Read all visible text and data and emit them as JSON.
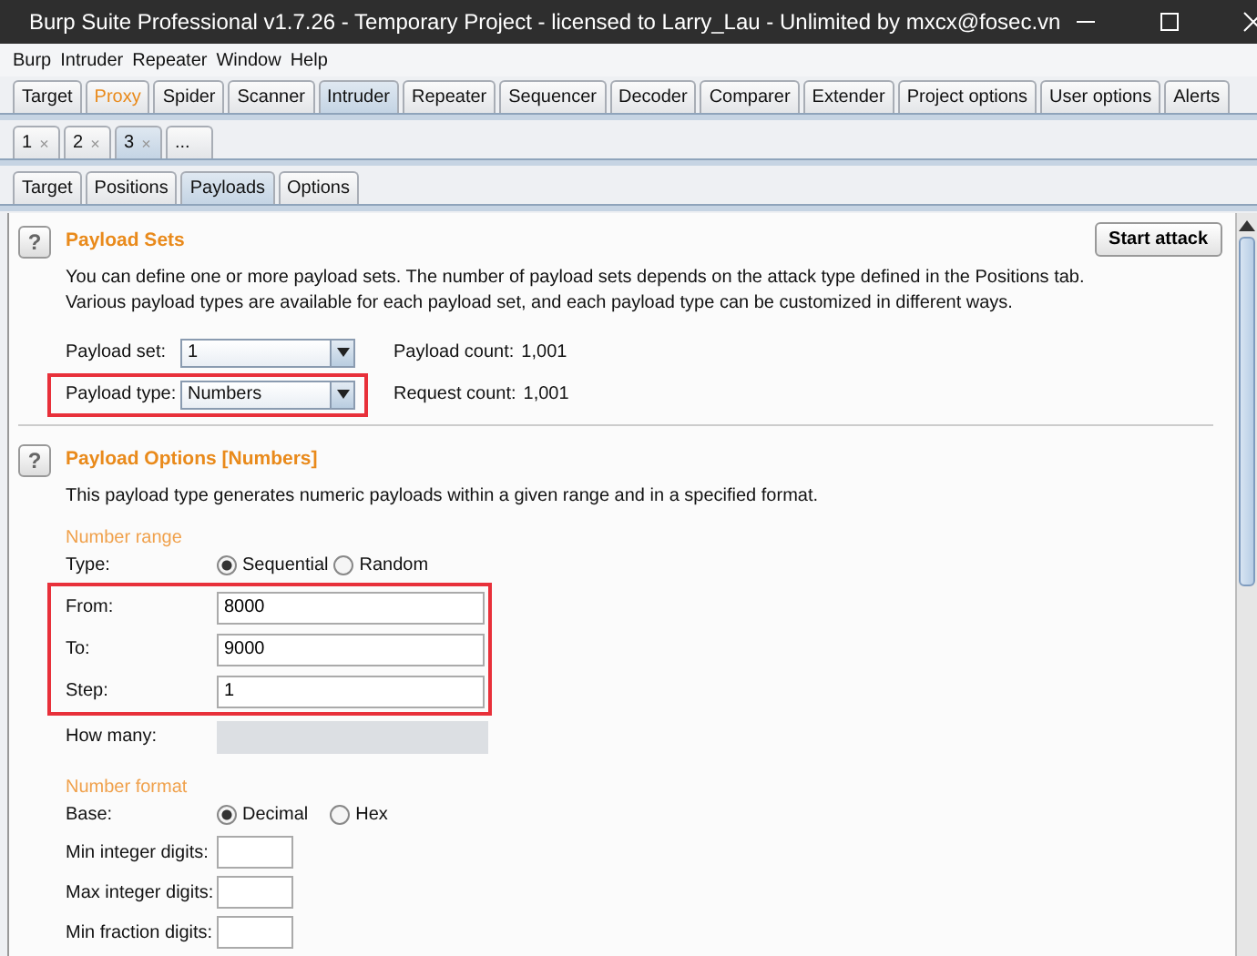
{
  "window": {
    "title": "Burp Suite Professional v1.7.26 - Temporary Project - licensed to Larry_Lau - Unlimited by mxcx@fosec.vn"
  },
  "menu": [
    "Burp",
    "Intruder",
    "Repeater",
    "Window",
    "Help"
  ],
  "main_tabs": [
    {
      "label": "Target",
      "selected": false,
      "flagged": false
    },
    {
      "label": "Proxy",
      "selected": false,
      "flagged": true
    },
    {
      "label": "Spider",
      "selected": false,
      "flagged": false
    },
    {
      "label": "Scanner",
      "selected": false,
      "flagged": false
    },
    {
      "label": "Intruder",
      "selected": true,
      "flagged": false
    },
    {
      "label": "Repeater",
      "selected": false,
      "flagged": false
    },
    {
      "label": "Sequencer",
      "selected": false,
      "flagged": false
    },
    {
      "label": "Decoder",
      "selected": false,
      "flagged": false
    },
    {
      "label": "Comparer",
      "selected": false,
      "flagged": false
    },
    {
      "label": "Extender",
      "selected": false,
      "flagged": false
    },
    {
      "label": "Project options",
      "selected": false,
      "flagged": false
    },
    {
      "label": "User options",
      "selected": false,
      "flagged": false
    },
    {
      "label": "Alerts",
      "selected": false,
      "flagged": false
    }
  ],
  "attack_tabs": [
    {
      "label": "1",
      "close": "×",
      "selected": false
    },
    {
      "label": "2",
      "close": "×",
      "selected": false
    },
    {
      "label": "3",
      "close": "×",
      "selected": true
    },
    {
      "label": "...",
      "selected": false
    }
  ],
  "sub_tabs": [
    {
      "label": "Target",
      "selected": false
    },
    {
      "label": "Positions",
      "selected": false
    },
    {
      "label": "Payloads",
      "selected": true
    },
    {
      "label": "Options",
      "selected": false
    }
  ],
  "payload_sets": {
    "help": "?",
    "title": "Payload Sets",
    "description": "You can define one or more payload sets. The number of payload sets depends on the attack type defined in the Positions tab. Various payload types are available for each payload set, and each payload type can be customized in different ways.",
    "start_button": "Start attack",
    "rows": [
      {
        "label": "Payload set:",
        "value": "1",
        "info_label": "Payload count:",
        "info_value": "1,001",
        "highlighted": false
      },
      {
        "label": "Payload type:",
        "value": "Numbers",
        "info_label": "Request count:",
        "info_value": "1,001",
        "highlighted": true
      }
    ]
  },
  "payload_options": {
    "help": "?",
    "title": "Payload Options [Numbers]",
    "description": "This payload type generates numeric payloads within a given range and in a specified format.",
    "number_range": {
      "title": "Number range",
      "type_label": "Type:",
      "type_options": [
        {
          "label": "Sequential",
          "selected": true
        },
        {
          "label": "Random",
          "selected": false
        }
      ],
      "highlighted": true,
      "fields": [
        {
          "label": "From:",
          "value": "8000"
        },
        {
          "label": "To:",
          "value": "9000"
        },
        {
          "label": "Step:",
          "value": "1"
        }
      ],
      "how_many": {
        "label": "How many:",
        "disabled": true
      }
    },
    "number_format": {
      "title": "Number format",
      "base_label": "Base:",
      "base_options": [
        {
          "label": "Decimal",
          "selected": true
        },
        {
          "label": "Hex",
          "selected": false
        }
      ],
      "fields": [
        {
          "label": "Min integer digits:"
        },
        {
          "label": "Max integer digits:"
        },
        {
          "label": "Min fraction digits:"
        }
      ]
    }
  }
}
